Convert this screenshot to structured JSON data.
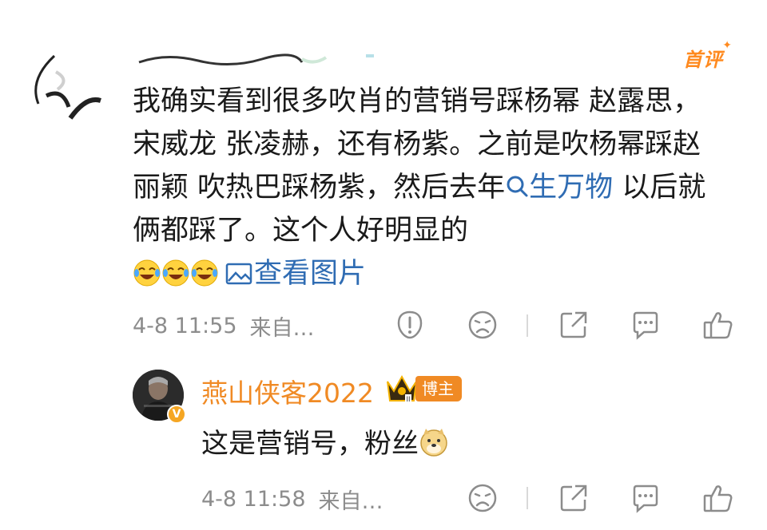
{
  "post": {
    "first_comment_badge": "首评",
    "text_part1": "我确实看到很多吹肖的营销号踩杨幂 赵露思，宋威龙 张凌赫，还有杨紫。之前是吹杨幂踩赵丽颖 吹热巴踩杨紫，然后去年",
    "link_text": "生万物",
    "text_part2": " 以后就俩都踩了。这个人好明显的",
    "view_image_label": "查看图片",
    "timestamp": "4-8 11:55",
    "source": "来自…",
    "icons": [
      "report-icon",
      "dislike-icon",
      "share-icon",
      "comment-icon",
      "like-icon"
    ]
  },
  "reply": {
    "username": "燕山侠客2022",
    "role_badge": "博主",
    "verified_mark": "V",
    "text": "这是营销号，粉丝",
    "timestamp": "4-8 11:58",
    "source": "来自…",
    "icons": [
      "dislike-icon",
      "share-icon",
      "comment-icon",
      "like-icon"
    ]
  },
  "colors": {
    "link": "#2f6cb3",
    "username": "#f08a24",
    "meta": "#8c8c8c",
    "badge": "#f08a24"
  }
}
